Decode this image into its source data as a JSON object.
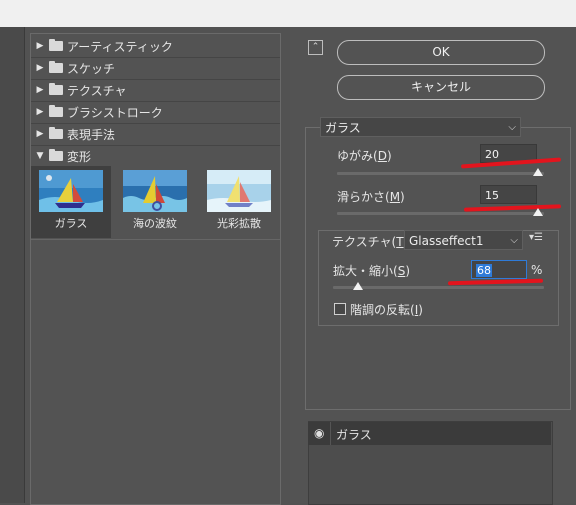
{
  "gallery": {
    "categories": [
      {
        "label": "アーティスティック",
        "expanded": false
      },
      {
        "label": "スケッチ",
        "expanded": false
      },
      {
        "label": "テクスチャ",
        "expanded": false
      },
      {
        "label": "ブラシストローク",
        "expanded": false
      },
      {
        "label": "表現手法",
        "expanded": false
      },
      {
        "label": "変形",
        "expanded": true
      }
    ],
    "filters": [
      {
        "label": "ガラス",
        "selected": true
      },
      {
        "label": "海の波紋",
        "selected": false
      },
      {
        "label": "光彩拡散",
        "selected": false
      }
    ]
  },
  "buttons": {
    "ok": "OK",
    "cancel": "キャンセル"
  },
  "filter_select": {
    "value": "ガラス"
  },
  "params": {
    "distortion": {
      "label": "ゆがみ(",
      "key": "D",
      "suffix": ")",
      "value": "20",
      "level": 20,
      "max": 20
    },
    "smoothness": {
      "label": "滑らかさ(",
      "key": "M",
      "suffix": ")",
      "value": "15",
      "level": 15,
      "max": 15
    }
  },
  "texture": {
    "label": "テクスチャ(",
    "key": "T",
    "suffix": ")：",
    "value": "Glasseffect1",
    "menu_icon": "▾☰",
    "scale": {
      "label": "拡大・縮小(",
      "key": "S",
      "suffix": ")",
      "value": "68",
      "unit": "%",
      "level": 68,
      "min": 50,
      "max": 200
    },
    "invert": {
      "label": "階調の反転(",
      "key": "I",
      "suffix": ")",
      "checked": false
    }
  },
  "layers": {
    "current": "ガラス"
  },
  "icons": {
    "collapse": "chevron-up-icon",
    "folder": "folder-icon",
    "visibility": "eye-icon"
  },
  "colors": {
    "background": "#525252",
    "annotation": "#e3141d",
    "selection": "#3f3f3f"
  }
}
